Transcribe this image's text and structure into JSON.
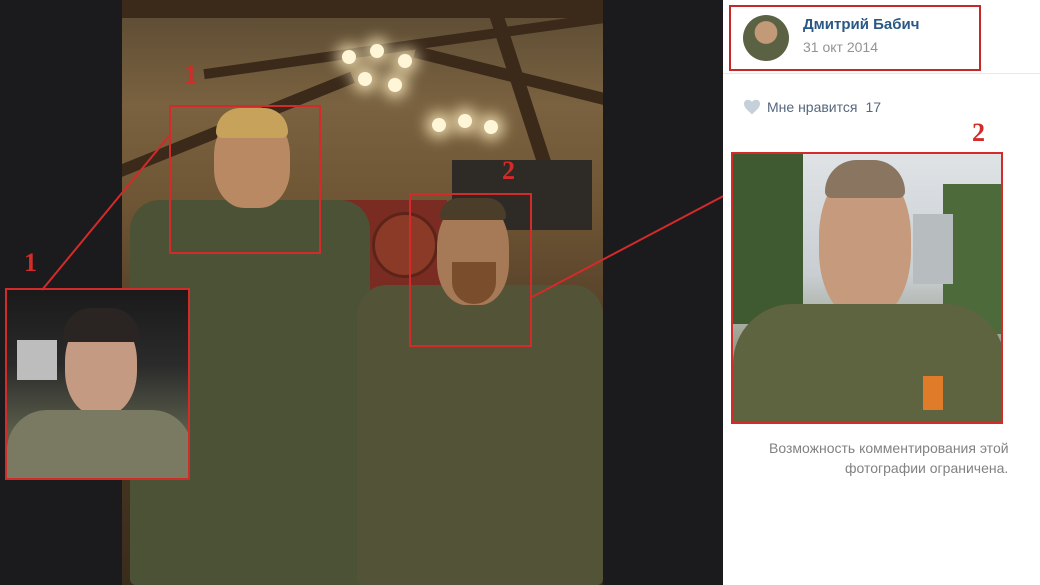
{
  "author": {
    "name": "Дмитрий Бабич",
    "date": "31 окт 2014"
  },
  "likes": {
    "label": "Мне нравится",
    "count": "17"
  },
  "comments_note": {
    "line1": "Возможность комментирования этой",
    "line2": "фотографии ограничена."
  },
  "annotations": {
    "label1": "1",
    "label2": "2"
  },
  "colors": {
    "annotation_red": "#d32a2a",
    "link_blue": "#2a5885",
    "muted_gray": "#939393",
    "viewer_bg": "#1b1b1d"
  },
  "icons": {
    "like": "heart-icon"
  }
}
